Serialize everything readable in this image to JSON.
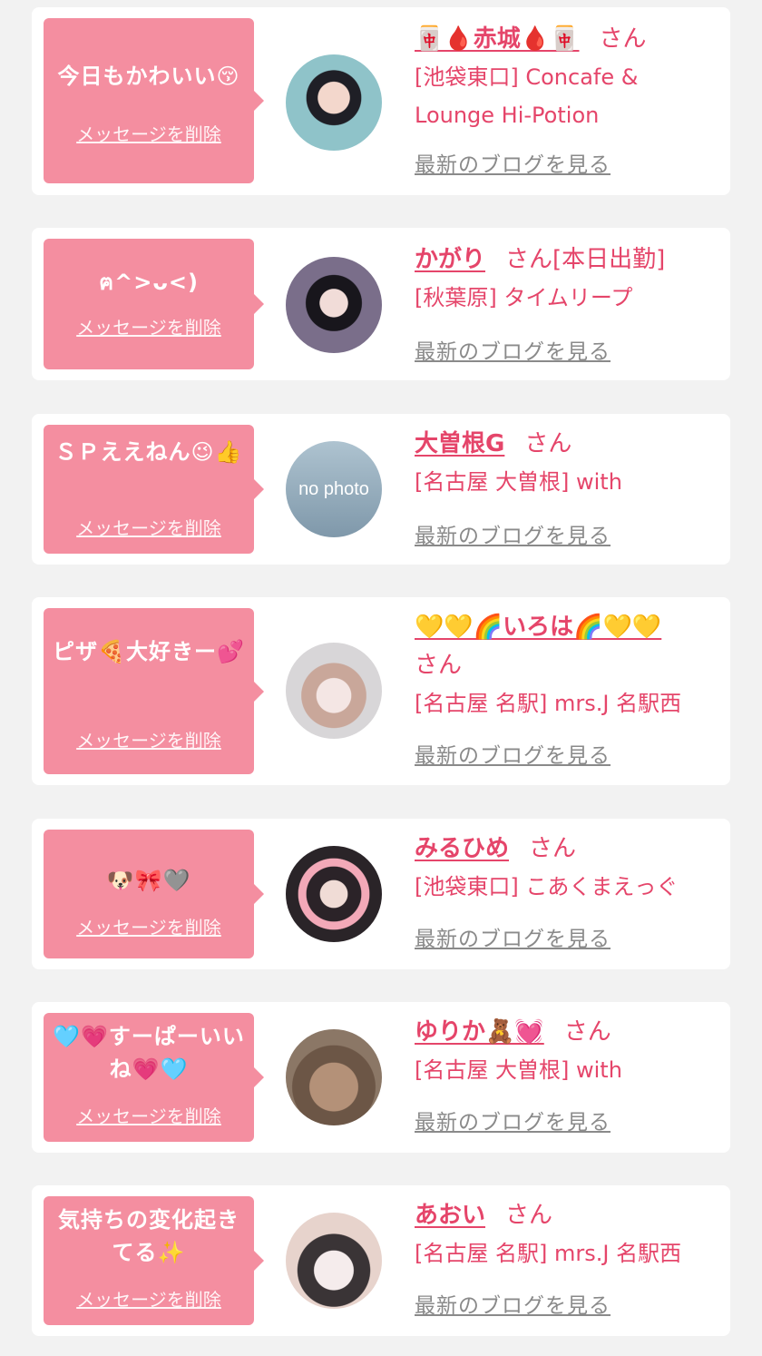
{
  "colors": {
    "background": "#f2f2f2",
    "card": "#ffffff",
    "bubble": "#f48ea0",
    "accent": "#e5456a",
    "link_gray": "#8a8a8a"
  },
  "cards": [
    {
      "message": "今日もかわいい😚",
      "delete_label": "メッセージを削除",
      "name": "🀄🩸赤城🩸🀄",
      "honorific": "さん",
      "shop_lines": [
        "[池袋東口] Concafe &",
        "Lounge Hi-Potion"
      ],
      "blog_link": "最新のブログを見る"
    },
    {
      "message": "ฅ^>ᴗ<)",
      "delete_label": "メッセージを削除",
      "name": "かがり",
      "honorific": "さん[本日出勤]",
      "shop_lines": [
        "[秋葉原] タイムリープ"
      ],
      "blog_link": "最新のブログを見る"
    },
    {
      "message": "ＳＰええねん😉👍",
      "delete_label": "メッセージを削除",
      "name": "大曽根G",
      "honorific": "さん",
      "shop_lines": [
        "[名古屋 大曽根] with"
      ],
      "blog_link": "最新のブログを見る",
      "avatar_text": "no photo"
    },
    {
      "message": "ピザ🍕大好きー💕",
      "delete_label": "メッセージを削除",
      "name": "💛💛🌈いろは🌈💛💛",
      "honorific": "さん",
      "shop_lines": [
        "[名古屋 名駅] mrs.J 名駅西"
      ],
      "blog_link": "最新のブログを見る"
    },
    {
      "message": "🐶🎀🩶",
      "delete_label": "メッセージを削除",
      "name": "みるひめ",
      "honorific": "さん",
      "shop_lines": [
        "[池袋東口] こあくまえっぐ"
      ],
      "blog_link": "最新のブログを見る"
    },
    {
      "message": "🩵💗すーぱーいいね💗🩵",
      "delete_label": "メッセージを削除",
      "name": "ゆりか🧸💓",
      "honorific": "さん",
      "shop_lines": [
        "[名古屋 大曽根] with"
      ],
      "blog_link": "最新のブログを見る"
    },
    {
      "message": "気持ちの変化起きてる✨",
      "delete_label": "メッセージを削除",
      "name": "あおい",
      "honorific": "さん",
      "shop_lines": [
        "[名古屋 名駅] mrs.J 名駅西"
      ],
      "blog_link": "最新のブログを見る"
    }
  ]
}
